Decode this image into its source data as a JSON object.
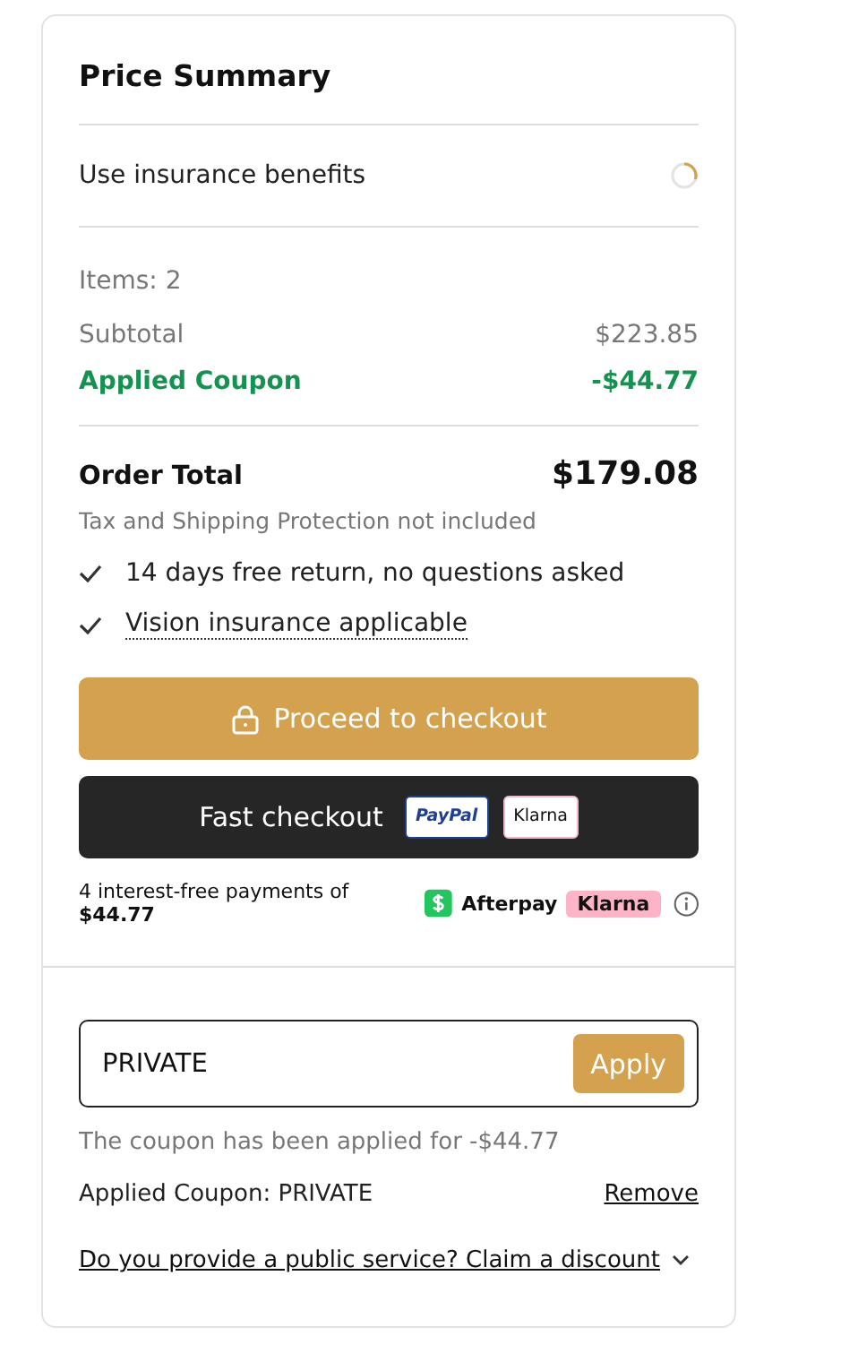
{
  "title": "Price Summary",
  "insurance": {
    "label": "Use insurance benefits"
  },
  "items_count": "Items: 2",
  "lines": [
    {
      "label": "Subtotal",
      "value": "$223.85",
      "kind": "plain"
    },
    {
      "label": "Applied Coupon",
      "value": "-$44.77",
      "kind": "discount"
    }
  ],
  "order_total": {
    "label": "Order Total",
    "value": "$179.08",
    "note": "Tax and Shipping Protection not included"
  },
  "perks": [
    {
      "text": "14 days free return, no questions asked",
      "kind": "plain"
    },
    {
      "text": "Vision insurance applicable",
      "kind": "link"
    }
  ],
  "checkout_button": "Proceed to checkout",
  "fast_checkout": {
    "label": "Fast checkout",
    "methods": [
      {
        "name": "PayPal",
        "kind": "paypal"
      },
      {
        "name": "Klarna",
        "kind": "klarna"
      }
    ]
  },
  "installments": {
    "text": "4 interest-free payments of **$44.77**",
    "providers": [
      {
        "name": "Afterpay",
        "kind": "afterpay"
      },
      {
        "name": "Klarna",
        "kind": "badge"
      }
    ]
  },
  "coupon": {
    "value": "PRIVATE",
    "button": "Apply",
    "message": "The coupon has been applied for -$44.77",
    "applied": "Applied Coupon: PRIVATE",
    "remove": "Remove"
  },
  "discount_link": "Do you provide a public service? Claim a discount"
}
